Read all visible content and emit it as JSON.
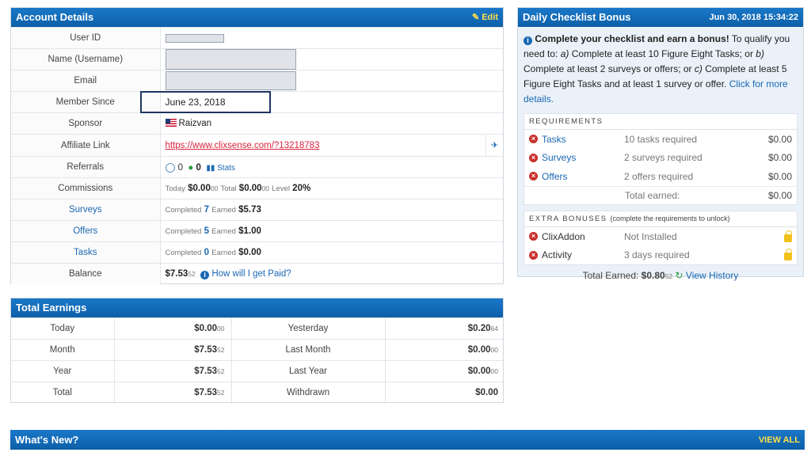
{
  "account": {
    "title": "Account Details",
    "edit_label": "Edit",
    "labels": {
      "user_id": "User ID",
      "name": "Name (Username)",
      "email": "Email",
      "member_since": "Member Since",
      "sponsor": "Sponsor",
      "affiliate": "Affiliate Link",
      "referrals": "Referrals",
      "commissions": "Commissions",
      "surveys": "Surveys",
      "offers": "Offers",
      "tasks": "Tasks",
      "balance": "Balance"
    },
    "member_since": "June 23, 2018",
    "sponsor": "Raizvan",
    "affiliate_link": "https://www.clixsense.com/?13218783",
    "referrals": {
      "a": "0",
      "b": "0",
      "stats": "Stats"
    },
    "commissions": {
      "today_label": "Today",
      "today": "$0.00",
      "today_cents": "00",
      "total_label": "Total",
      "total": "$0.00",
      "total_cents": "00",
      "level_label": "Level",
      "level": "20%"
    },
    "surveys": {
      "completed_label": "Completed",
      "completed": "7",
      "earned_label": "Earned",
      "earned": "$5.73"
    },
    "offers": {
      "completed_label": "Completed",
      "completed": "5",
      "earned_label": "Earned",
      "earned": "$1.00"
    },
    "tasks": {
      "completed_label": "Completed",
      "completed": "0",
      "earned_label": "Earned",
      "earned": "$0.00"
    },
    "balance": {
      "value": "$7.53",
      "cents": "52",
      "help": "How will I get Paid?"
    }
  },
  "earnings": {
    "title": "Total Earnings",
    "rows": [
      {
        "l1": "Today",
        "v1": "$0.00",
        "c1": "00",
        "l2": "Yesterday",
        "v2": "$0.20",
        "c2": "64"
      },
      {
        "l1": "Month",
        "v1": "$7.53",
        "c1": "52",
        "l2": "Last Month",
        "v2": "$0.00",
        "c2": "00"
      },
      {
        "l1": "Year",
        "v1": "$7.53",
        "c1": "52",
        "l2": "Last Year",
        "v2": "$0.00",
        "c2": "00"
      },
      {
        "l1": "Total",
        "v1": "$7.53",
        "c1": "52",
        "l2": "Withdrawn",
        "v2": "$0.00",
        "c2": ""
      }
    ]
  },
  "whatsnew": {
    "title": "What's New?",
    "view_all": "VIEW ALL"
  },
  "checklist": {
    "title": "Daily Checklist Bonus",
    "date": "Jun 30, 2018 15:34:22",
    "intro_bold": "Complete your checklist and earn a bonus!",
    "intro_rest_1": " To qualify you need to: ",
    "a_label": "a)",
    "a_text": " Complete at least 10 Figure Eight Tasks; or ",
    "b_label": "b)",
    "b_text": " Complete at least 2 surveys or offers; or ",
    "c_label": "c)",
    "c_text": " Complete at least 5 Figure Eight Tasks and at least 1 survey or offer. ",
    "more_link": "Click for more details.",
    "requirements_title": "REQUIREMENTS",
    "requirements": [
      {
        "name": "Tasks",
        "desc": "10 tasks required",
        "amount": "$0.00"
      },
      {
        "name": "Surveys",
        "desc": "2 surveys required",
        "amount": "$0.00"
      },
      {
        "name": "Offers",
        "desc": "2 offers required",
        "amount": "$0.00"
      }
    ],
    "total_earned_label": "Total earned:",
    "total_earned": "$0.00",
    "extra_title": "EXTRA BONUSES",
    "extra_note": "(complete the requirements to unlock)",
    "extras": [
      {
        "name": "ClixAddon",
        "desc": "Not Installed"
      },
      {
        "name": "Activity",
        "desc": "3 days required"
      }
    ],
    "footer_label": "Total Earned:",
    "footer_value": "$0.80",
    "footer_cents": "52",
    "view_history": "View History"
  }
}
